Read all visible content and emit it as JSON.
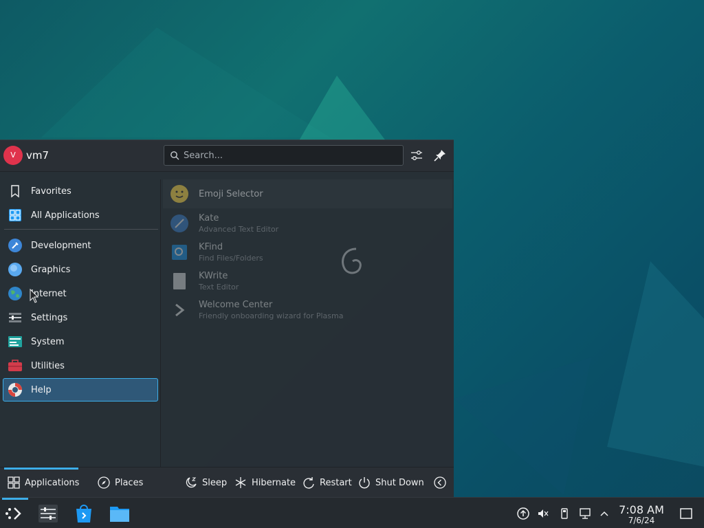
{
  "user": {
    "initial": "V",
    "name": "vm7"
  },
  "search": {
    "placeholder": "Search..."
  },
  "sidebar": {
    "items": [
      {
        "label": "Favorites",
        "icon": "bookmark-icon"
      },
      {
        "label": "All Applications",
        "icon": "grid-icon"
      },
      {
        "label": "Development",
        "icon": "development-icon"
      },
      {
        "label": "Graphics",
        "icon": "graphics-icon"
      },
      {
        "label": "Internet",
        "icon": "internet-globe-icon"
      },
      {
        "label": "Settings",
        "icon": "settings-icon"
      },
      {
        "label": "System",
        "icon": "system-icon"
      },
      {
        "label": "Utilities",
        "icon": "utilities-icon"
      },
      {
        "label": "Help",
        "icon": "help-lifebuoy-icon",
        "active": true
      }
    ]
  },
  "apps": [
    {
      "name": "Emoji Selector",
      "description": ""
    },
    {
      "name": "Kate",
      "description": "Advanced Text Editor"
    },
    {
      "name": "KFind",
      "description": "Find Files/Folders"
    },
    {
      "name": "KWrite",
      "description": "Text Editor"
    },
    {
      "name": "Welcome Center",
      "description": "Friendly onboarding wizard for Plasma"
    }
  ],
  "footer": {
    "tabs": {
      "applications": "Applications",
      "places": "Places"
    },
    "actions": {
      "sleep": "Sleep",
      "hibernate": "Hibernate",
      "restart": "Restart",
      "shutdown": "Shut Down"
    }
  },
  "taskbar": {
    "clock": {
      "time": "7:08 AM",
      "date": "7/6/24"
    }
  },
  "colors": {
    "accent": "#3daee9",
    "avatar": "#e0334c",
    "panel": "#2a2f35"
  }
}
